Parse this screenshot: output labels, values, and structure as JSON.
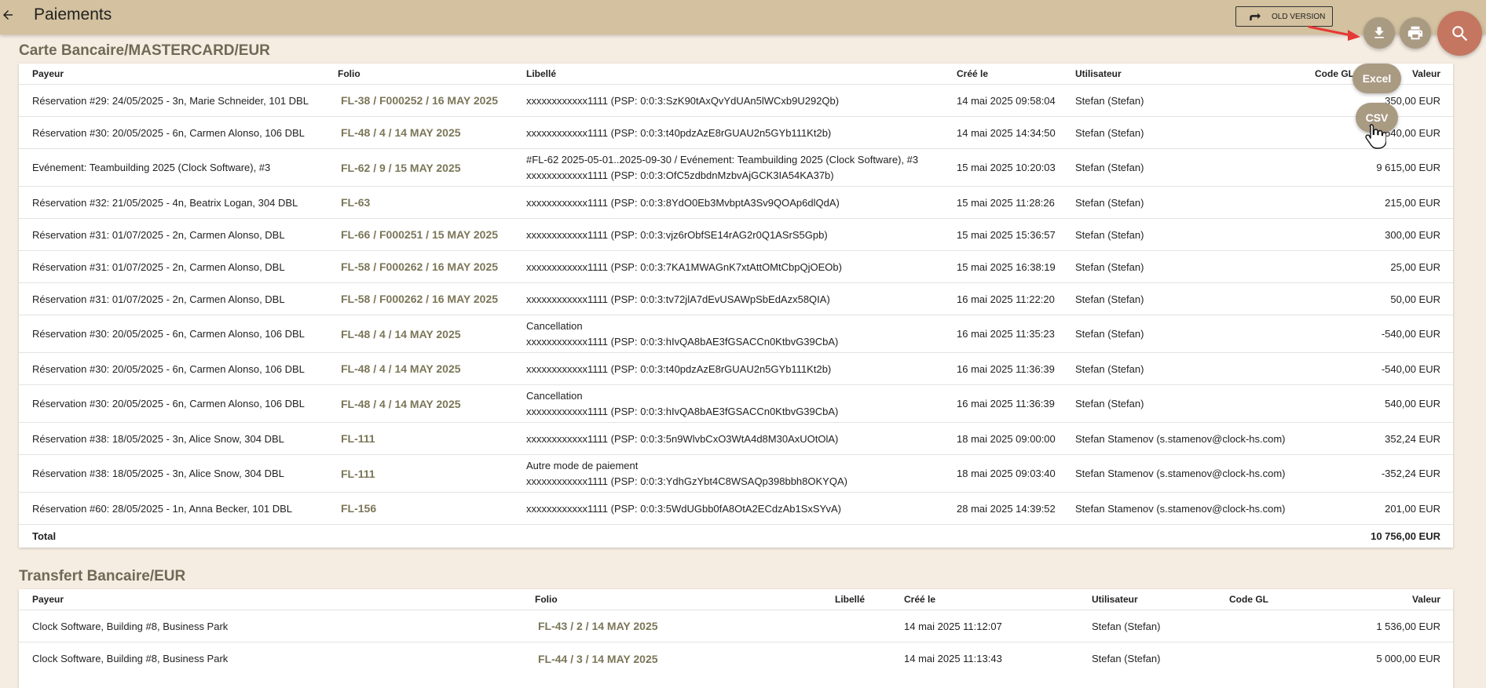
{
  "header": {
    "title": "Paiements",
    "old_version_label": "OLD VERSION"
  },
  "export_menu": {
    "excel_label": "Excel",
    "csv_label": "CSV"
  },
  "icons": {
    "back": "arrow-left-icon",
    "old_version": "redo-arrow-icon",
    "download": "download-icon",
    "print": "printer-icon",
    "search": "search-icon"
  },
  "colors": {
    "topbar": "#d3c19f",
    "background": "#f5ece2",
    "fab": "#a99a82",
    "search_fab": "#c47661",
    "folio_text": "#7b7658",
    "arrow": "#e53935"
  },
  "card_section": {
    "title": "Carte Bancaire/MASTERCARD/EUR",
    "headers": {
      "payeur": "Payeur",
      "folio": "Folio",
      "libelle": "Libellé",
      "cree_le": "Créé le",
      "utilisateur": "Utilisateur",
      "code_gl": "Code GL",
      "valeur": "Valeur"
    },
    "rows": [
      {
        "payeur": "Réservation #29: 24/05/2025 - 3n, Marie Schneider, 101 DBL",
        "folio": "FL-38 / F000252 / 16 MAY 2025",
        "libelle1": "xxxxxxxxxxxx1111 (PSP: 0:0:3:SzK90tAxQvYdUAn5lWCxb9U292Qb)",
        "libelle2": "",
        "cree_le": "14 mai 2025 09:58:04",
        "utilisateur": "Stefan (Stefan)",
        "valeur": "350,00 EUR"
      },
      {
        "payeur": "Réservation #30: 20/05/2025 - 6n, Carmen Alonso, 106 DBL",
        "folio": "FL-48 / 4 / 14 MAY 2025",
        "libelle1": "xxxxxxxxxxxx1111 (PSP: 0:0:3:t40pdzAzE8rGUAU2n5GYb111Kt2b)",
        "libelle2": "",
        "cree_le": "14 mai 2025 14:34:50",
        "utilisateur": "Stefan (Stefan)",
        "valeur": "540,00 EUR"
      },
      {
        "payeur": "Evénement: Teambuilding 2025 (Clock Software), #3",
        "folio": "FL-62 / 9 / 15 MAY 2025",
        "libelle1": "#FL-62 2025-05-01..2025-09-30 / Evénement: Teambuilding 2025 (Clock Software), #3",
        "libelle2": "xxxxxxxxxxxx1111 (PSP: 0:0:3:OfC5zdbdnMzbvAjGCK3IA54KA37b)",
        "cree_le": "15 mai 2025 10:20:03",
        "utilisateur": "Stefan (Stefan)",
        "valeur": "9 615,00 EUR"
      },
      {
        "payeur": "Réservation #32: 21/05/2025 - 4n, Beatrix Logan, 304 DBL",
        "folio": "FL-63",
        "libelle1": "xxxxxxxxxxxx1111 (PSP: 0:0:3:8YdO0Eb3MvbptA3Sv9QOAp6dlQdA)",
        "libelle2": "",
        "cree_le": "15 mai 2025 11:28:26",
        "utilisateur": "Stefan (Stefan)",
        "valeur": "215,00 EUR"
      },
      {
        "payeur": "Réservation #31: 01/07/2025 - 2n, Carmen Alonso, DBL",
        "folio": "FL-66 / F000251 / 15 MAY 2025",
        "libelle1": "xxxxxxxxxxxx1111 (PSP: 0:0:3:vjz6rObfSE14rAG2r0Q1ASrS5Gpb)",
        "libelle2": "",
        "cree_le": "15 mai 2025 15:36:57",
        "utilisateur": "Stefan (Stefan)",
        "valeur": "300,00 EUR"
      },
      {
        "payeur": "Réservation #31: 01/07/2025 - 2n, Carmen Alonso, DBL",
        "folio": "FL-58 / F000262 / 16 MAY 2025",
        "libelle1": "xxxxxxxxxxxx1111 (PSP: 0:0:3:7KA1MWAGnK7xtAttOMtCbpQjOEOb)",
        "libelle2": "",
        "cree_le": "15 mai 2025 16:38:19",
        "utilisateur": "Stefan (Stefan)",
        "valeur": "25,00 EUR"
      },
      {
        "payeur": "Réservation #31: 01/07/2025 - 2n, Carmen Alonso, DBL",
        "folio": "FL-58 / F000262 / 16 MAY 2025",
        "libelle1": "xxxxxxxxxxxx1111 (PSP: 0:0:3:tv72jlA7dEvUSAWpSbEdAzx58QIA)",
        "libelle2": "",
        "cree_le": "16 mai 2025 11:22:20",
        "utilisateur": "Stefan (Stefan)",
        "valeur": "50,00 EUR"
      },
      {
        "payeur": "Réservation #30: 20/05/2025 - 6n, Carmen Alonso, 106 DBL",
        "folio": "FL-48 / 4 / 14 MAY 2025",
        "libelle1": "Cancellation",
        "libelle2": "xxxxxxxxxxxx1111 (PSP: 0:0:3:hIvQA8bAE3fGSACCn0KtbvG39CbA)",
        "cree_le": "16 mai 2025 11:35:23",
        "utilisateur": "Stefan (Stefan)",
        "valeur": "-540,00 EUR"
      },
      {
        "payeur": "Réservation #30: 20/05/2025 - 6n, Carmen Alonso, 106 DBL",
        "folio": "FL-48 / 4 / 14 MAY 2025",
        "libelle1": "xxxxxxxxxxxx1111 (PSP: 0:0:3:t40pdzAzE8rGUAU2n5GYb111Kt2b)",
        "libelle2": "",
        "cree_le": "16 mai 2025 11:36:39",
        "utilisateur": "Stefan (Stefan)",
        "valeur": "-540,00 EUR"
      },
      {
        "payeur": "Réservation #30: 20/05/2025 - 6n, Carmen Alonso, 106 DBL",
        "folio": "FL-48 / 4 / 14 MAY 2025",
        "libelle1": "Cancellation",
        "libelle2": "xxxxxxxxxxxx1111 (PSP: 0:0:3:hIvQA8bAE3fGSACCn0KtbvG39CbA)",
        "cree_le": "16 mai 2025 11:36:39",
        "utilisateur": "Stefan (Stefan)",
        "valeur": "540,00 EUR"
      },
      {
        "payeur": "Réservation #38: 18/05/2025 - 3n, Alice Snow, 304 DBL",
        "folio": "FL-111",
        "libelle1": "xxxxxxxxxxxx1111 (PSP: 0:0:3:5n9WlvbCxO3WtA4d8M30AxUOtOlA)",
        "libelle2": "",
        "cree_le": "18 mai 2025 09:00:00",
        "utilisateur": "Stefan Stamenov (s.stamenov@clock-hs.com)",
        "valeur": "352,24 EUR"
      },
      {
        "payeur": "Réservation #38: 18/05/2025 - 3n, Alice Snow, 304 DBL",
        "folio": "FL-111",
        "libelle1": "Autre mode de paiement",
        "libelle2": "xxxxxxxxxxxx1111 (PSP: 0:0:3:YdhGzYbt4C8WSAQp398bbh8OKYQA)",
        "cree_le": "18 mai 2025 09:03:40",
        "utilisateur": "Stefan Stamenov (s.stamenov@clock-hs.com)",
        "valeur": "-352,24 EUR"
      },
      {
        "payeur": "Réservation #60: 28/05/2025 - 1n, Anna Becker, 101 DBL",
        "folio": "FL-156",
        "libelle1": "xxxxxxxxxxxx1111 (PSP: 0:0:3:5WdUGbb0fA8OtA2ECdzAb1SxSYvA)",
        "libelle2": "",
        "cree_le": "28 mai 2025 14:39:52",
        "utilisateur": "Stefan Stamenov (s.stamenov@clock-hs.com)",
        "valeur": "201,00 EUR"
      }
    ],
    "total_label": "Total",
    "total_value": "10 756,00 EUR"
  },
  "transfer_section": {
    "title": "Transfert Bancaire/EUR",
    "headers": {
      "payeur": "Payeur",
      "folio": "Folio",
      "libelle": "Libellé",
      "cree_le": "Créé le",
      "utilisateur": "Utilisateur",
      "code_gl": "Code GL",
      "valeur": "Valeur"
    },
    "rows": [
      {
        "payeur": "Clock Software, Building #8, Business Park",
        "folio": "FL-43 / 2 / 14 MAY 2025",
        "cree_le": "14 mai 2025 11:12:07",
        "utilisateur": "Stefan (Stefan)",
        "valeur": "1 536,00 EUR"
      },
      {
        "payeur": "Clock Software, Building #8, Business Park",
        "folio": "FL-44 / 3 / 14 MAY 2025",
        "cree_le": "14 mai 2025 11:13:43",
        "utilisateur": "Stefan (Stefan)",
        "valeur": "5 000,00 EUR"
      }
    ]
  }
}
